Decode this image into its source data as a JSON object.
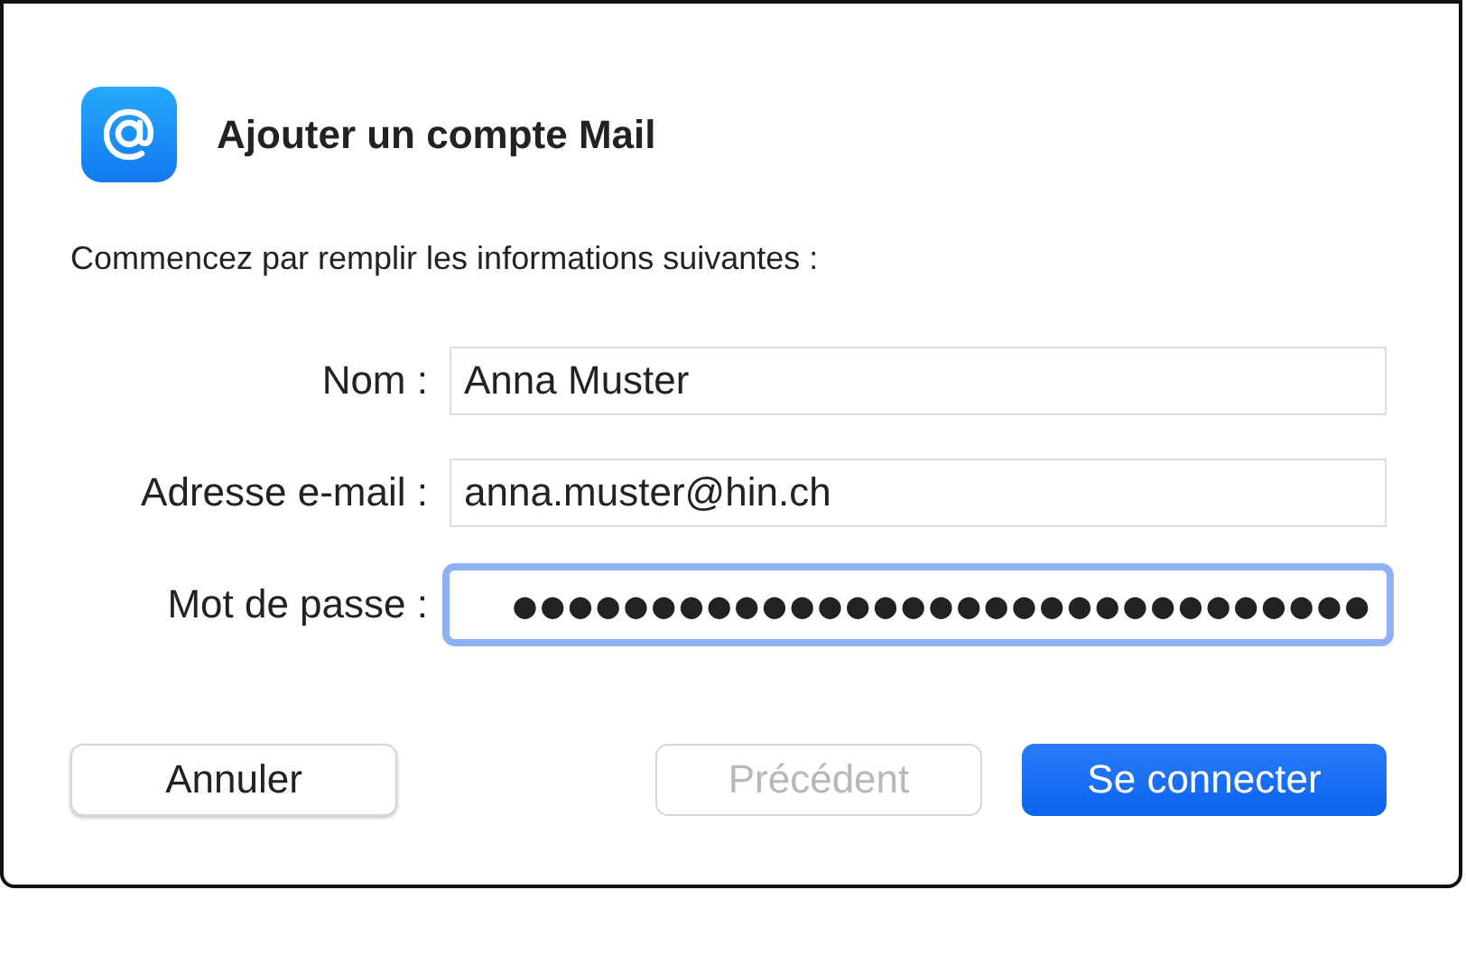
{
  "dialog": {
    "title": "Ajouter un compte Mail",
    "intro": "Commencez par remplir les informations suivantes :"
  },
  "fields": [
    {
      "label": "Nom :",
      "value": "Anna Muster",
      "focused": false
    },
    {
      "label": "Adresse e-mail :",
      "value": "anna.muster@hin.ch",
      "focused": false
    },
    {
      "label": "Mot de passe :",
      "value": "●●●●●●●●●●●●●●●●●●●●●●●●●●●●●●●",
      "focused": true
    }
  ],
  "buttons": [
    {
      "label": "Annuler",
      "kind": "secondary",
      "disabled": false
    },
    {
      "label": "Précédent",
      "kind": "secondary",
      "disabled": true
    },
    {
      "label": "Se connecter",
      "kind": "primary",
      "disabled": false
    }
  ]
}
